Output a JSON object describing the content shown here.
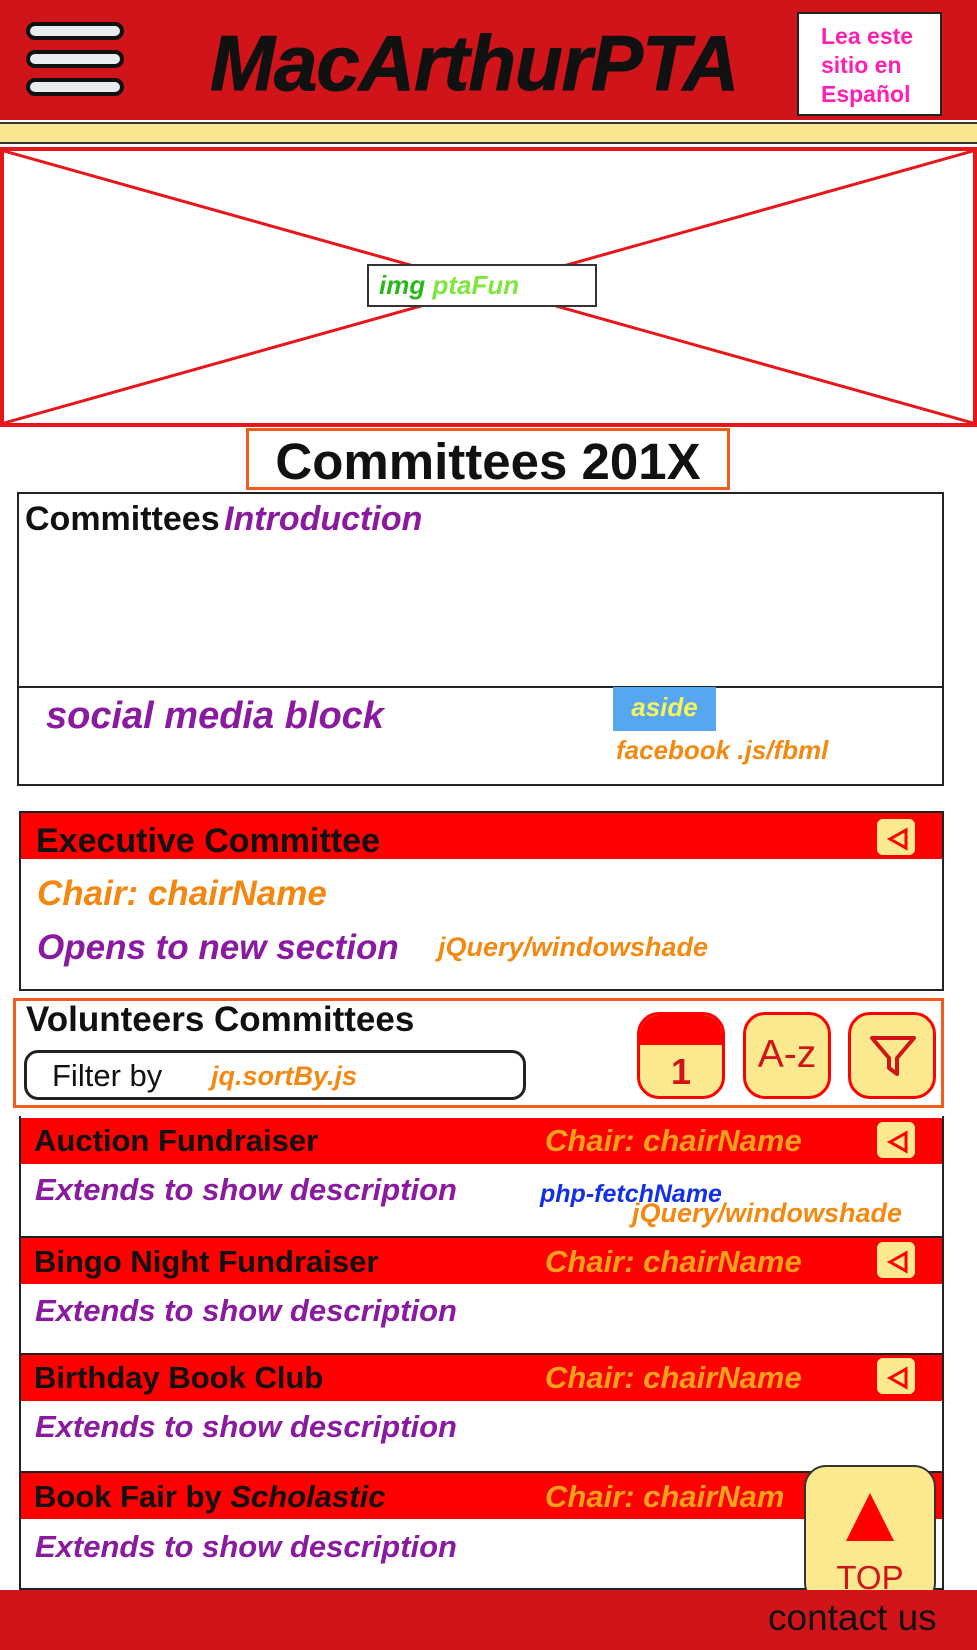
{
  "header": {
    "title": "MacArthurPTA",
    "language_link": [
      "Lea este",
      "sitio en",
      "Español"
    ]
  },
  "hero": {
    "label_prefix": "img",
    "label_name": "ptaFun"
  },
  "page_title": "Committees 201X",
  "intro": {
    "title": "Committees",
    "subtitle": "Introduction"
  },
  "social": {
    "label": "social media block",
    "aside_tag": "aside",
    "tech_note": "facebook .js/fbml"
  },
  "executive": {
    "title": "Executive Committee",
    "chair": "Chair: chairName",
    "note": "Opens to new section",
    "tech_note": "jQuery/windowshade"
  },
  "volunteers": {
    "title": "Volunteers Committees",
    "filter_placeholder": "Filter by",
    "filter_tech": "jq.sortBy.js",
    "calendar_number": "1",
    "sort_label": "A-z"
  },
  "committees": [
    {
      "name": "Auction Fundraiser",
      "chair": "Chair: chairName",
      "description": "Extends to show description"
    },
    {
      "name": "Bingo Night Fundraiser",
      "chair": "Chair: chairName",
      "description": "Extends to show description"
    },
    {
      "name": "Birthday Book Club",
      "chair": "Chair: chairName",
      "description": "Extends to show description"
    },
    {
      "name_prefix": "Book Fair by ",
      "name_italic": "Scholastic",
      "chair": "Chair: chairNam",
      "description": "Extends to show description"
    }
  ],
  "row_notes": {
    "php": "php-fetchName",
    "tech": "jQuery/windowshade"
  },
  "top_button": "TOP",
  "footer": {
    "contact": "contact us"
  },
  "colors": {
    "header_red": "#d01419",
    "accent_red": "#ff0000",
    "yellow": "#fbe98f",
    "purple": "#8a1aa0",
    "orange": "#f28a12",
    "pink": "#ff1fb3"
  }
}
